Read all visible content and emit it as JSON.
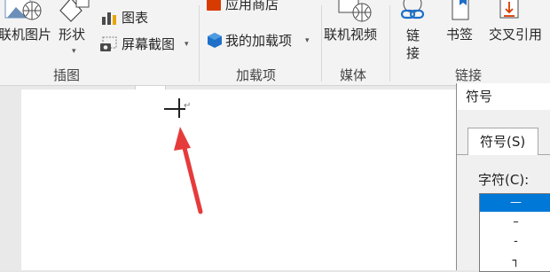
{
  "ribbon": {
    "insert_group": {
      "online_pictures": "联机图片",
      "shapes": "形状",
      "chart": "图表",
      "screenshot": "屏幕截图",
      "label": "插图"
    },
    "addins_group": {
      "store": "应用商店",
      "my_addins": "我的加载项",
      "label": "加载项"
    },
    "media_group": {
      "online_video": "联机视频",
      "label": "媒体"
    },
    "links_group": {
      "link": "链接",
      "bookmark": "书签",
      "cross_ref": "交叉引用",
      "label": "链接"
    }
  },
  "document": {
    "paragraph_mark": "↵",
    "inserted_char": "—"
  },
  "symbol_dialog": {
    "title": "符号",
    "tab_symbols": "符号(S)",
    "chars_label": "字符(C):",
    "chars": [
      "—",
      "–",
      "-",
      "┐"
    ],
    "selected_index": 0
  },
  "colors": {
    "accent": "#0078d7",
    "arrow": "#e63b3b",
    "office_icon_orange": "#d83b01"
  }
}
